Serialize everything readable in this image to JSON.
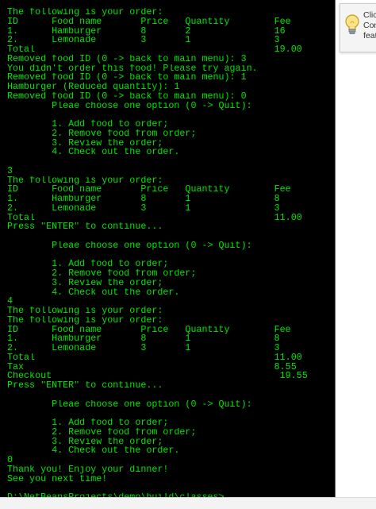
{
  "console": {
    "lines": [
      "The following is your order:",
      "ID      Food name       Price   Quantity        Fee",
      "1.      Hamburger       8       2               16",
      "2.      Lemonade        3       1               3",
      "Total                                           19.00",
      "Removed food ID (0 -> back to main menu): 3",
      "You didn't order this food! Please try again.",
      "Removed food ID (0 -> back to main menu): 1",
      "Hamburger (Reduced quantity): 1",
      "Removed food ID (0 -> back to main menu): 0",
      "        Pleae choose one option (0 -> Quit):",
      "",
      "        1. Add food to order;",
      "        2. Remove food from order;",
      "        3. Review the order;",
      "        4. Check out the order.",
      "",
      "3",
      "The following is your order:",
      "ID      Food name       Price   Quantity        Fee",
      "1.      Hamburger       8       1               8",
      "2.      Lemonade        3       1               3",
      "Total                                           11.00",
      "Press \"ENTER\" to continue...",
      "",
      "        Pleae choose one option (0 -> Quit):",
      "",
      "        1. Add food to order;",
      "        2. Remove food from order;",
      "        3. Review the order;",
      "        4. Check out the order.",
      "4",
      "The following is your order:",
      "The following is your order:",
      "ID      Food name       Price   Quantity        Fee",
      "1.      Hamburger       8       1               8",
      "2.      Lemonade        3       1               3",
      "Total                                           11.00",
      "Tax                                             8.55",
      "Checkout                                         19.55",
      "Press \"ENTER\" to continue...",
      "",
      "        Pleae choose one option (0 -> Quit):",
      "",
      "        1. Add food to order;",
      "        2. Remove food from order;",
      "        3. Review the order;",
      "        4. Check out the order.",
      "0",
      "Thank you! Enjoy your dinner!",
      "See you next time!",
      "",
      "D:\\NetBeansProjects\\demo\\build\\classes>"
    ]
  },
  "tip": {
    "icon": "lightbulb-icon",
    "text_lines": [
      "Clic",
      "Con",
      "feat"
    ]
  },
  "colors": {
    "console_bg": "#000000",
    "console_text": "#00e600",
    "bulb": "#f5c242"
  }
}
